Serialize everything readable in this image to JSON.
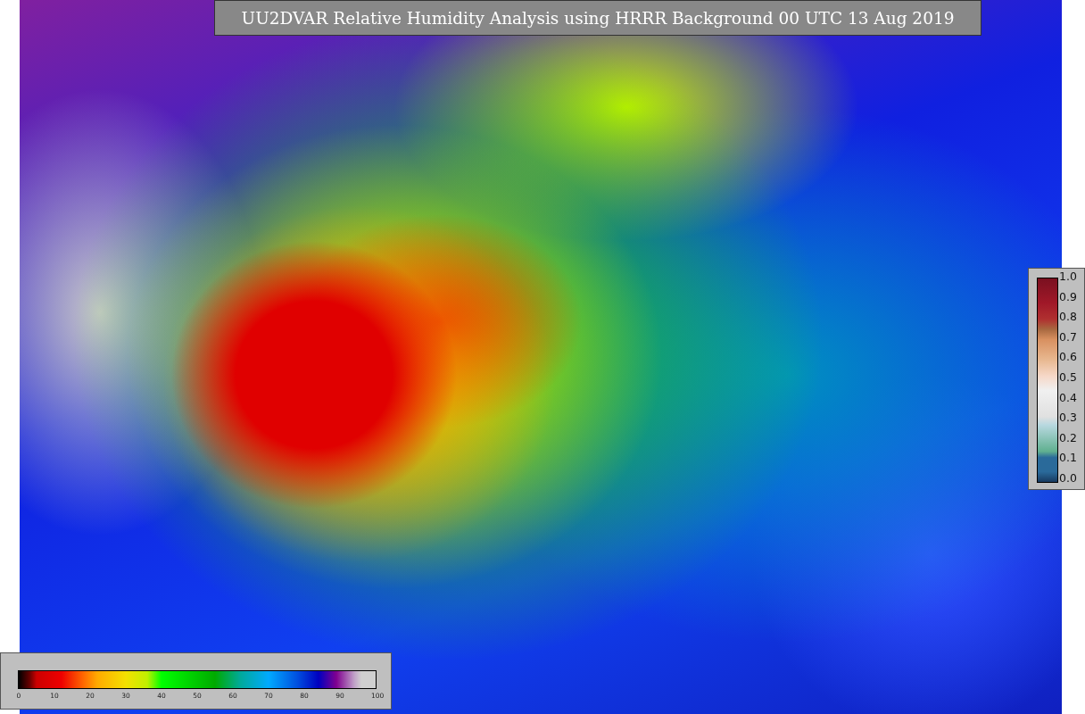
{
  "title": "UU2DVAR Relative Humidity Analysis using HRRR Background 00 UTC 13 Aug 2019",
  "bottom_colorbar": {
    "ticks": [
      "0",
      "10",
      "20",
      "30",
      "40",
      "50",
      "60",
      "70",
      "80",
      "90",
      "100"
    ]
  },
  "side_colorbar": {
    "ticks": [
      "1.0",
      "0.9",
      "0.8",
      "0.7",
      "0.6",
      "0.5",
      "0.4",
      "0.3",
      "0.2",
      "0.1",
      "0.0"
    ]
  }
}
